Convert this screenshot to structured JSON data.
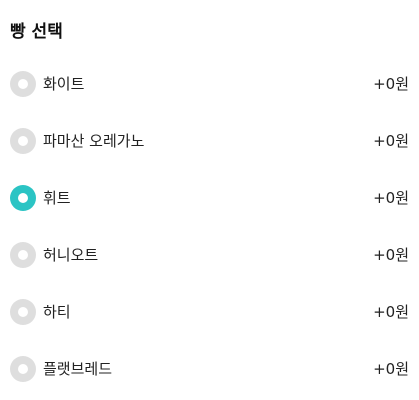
{
  "section": {
    "title": "빵 선택"
  },
  "options": [
    {
      "label": "화이트",
      "price": "+0원",
      "selected": false
    },
    {
      "label": "파마산 오레가노",
      "price": "+0원",
      "selected": false
    },
    {
      "label": "휘트",
      "price": "+0원",
      "selected": true
    },
    {
      "label": "허니오트",
      "price": "+0원",
      "selected": false
    },
    {
      "label": "하티",
      "price": "+0원",
      "selected": false
    },
    {
      "label": "플랫브레드",
      "price": "+0원",
      "selected": false
    }
  ],
  "colors": {
    "accent": "#2bc4c4",
    "radio_unselected": "#dedede"
  },
  "icons": {
    "radio": "radio-button-icon"
  }
}
